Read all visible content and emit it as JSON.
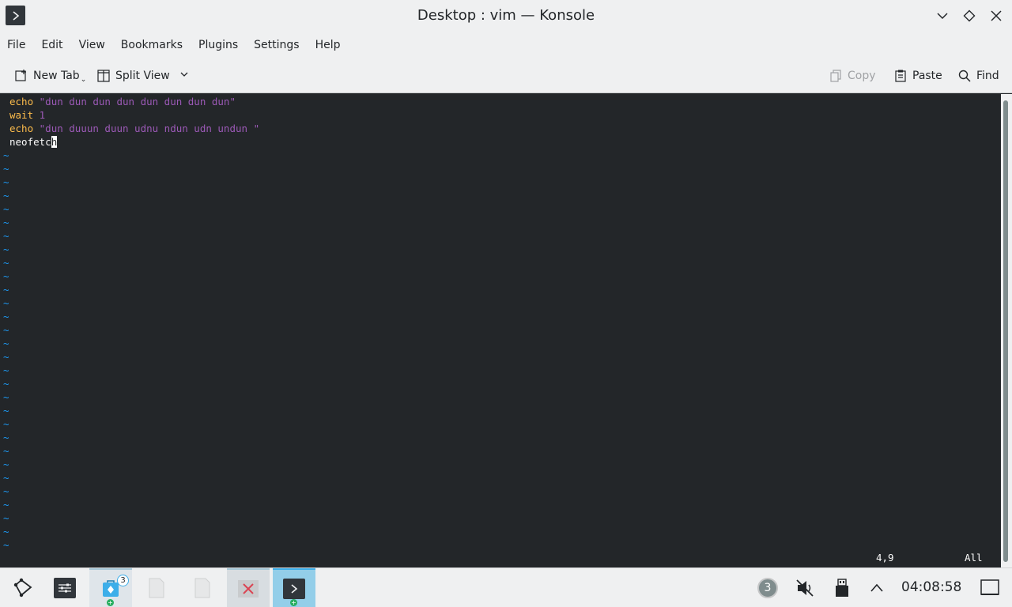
{
  "window": {
    "title": "Desktop : vim — Konsole"
  },
  "menu": [
    "File",
    "Edit",
    "View",
    "Bookmarks",
    "Plugins",
    "Settings",
    "Help"
  ],
  "toolbar": {
    "new_tab": "New Tab",
    "split_view": "Split View",
    "copy": "Copy",
    "paste": "Paste",
    "find": "Find"
  },
  "editor": {
    "line1_kw": "echo",
    "line1_str": "\"dun dun dun dun dun dun dun dun\"",
    "line2_kw": "wait",
    "line2_num": "1",
    "line3_kw": "echo",
    "line3_str": "\"dun duuun duun udnu ndun udn undun \"",
    "line4_text": "neofetc",
    "line4_cursor": "h",
    "tilde": "~",
    "position": "4,9",
    "scroll": "All"
  },
  "taskbar": {
    "badge_count": "3",
    "tray_notifications": "3",
    "clock": "04:08:58"
  },
  "colors": {
    "keyword": "#fdbc4b",
    "string": "#9b59b6",
    "tilde": "#1d99f3",
    "background": "#232629"
  },
  "icons": {
    "app": "konsole-icon",
    "minimize": "chevron-down-icon",
    "maximize": "diamond-icon",
    "close": "close-icon"
  }
}
